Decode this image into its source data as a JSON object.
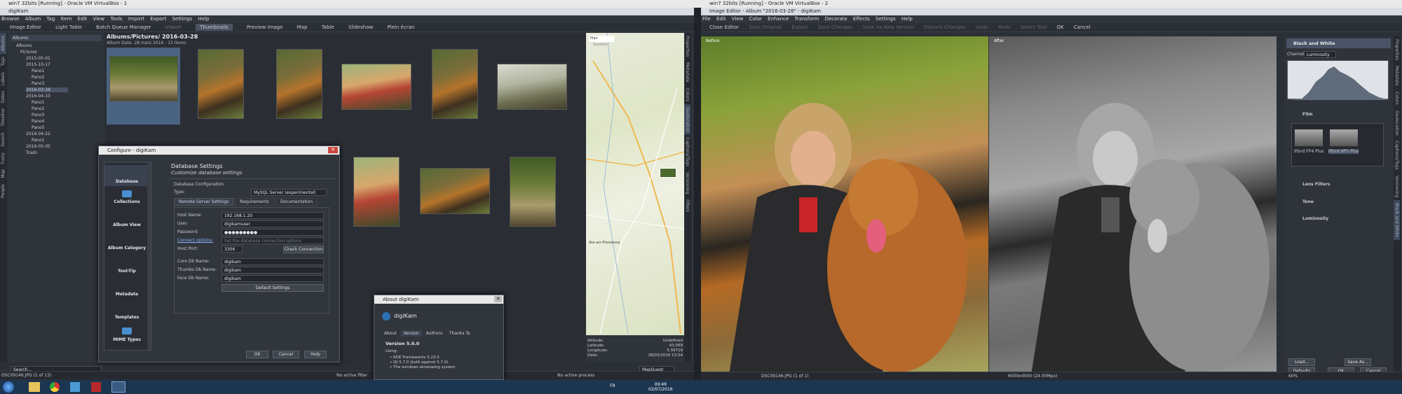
{
  "vm_bar": {
    "left_title": "win7 32bits [Running] - Oracle VM VirtualBox - 1",
    "right_title": "win7 32bits [Running] - Oracle VM VirtualBox - 2"
  },
  "digikam": {
    "title": "digiKam",
    "menu": [
      "Browse",
      "Album",
      "Tag",
      "Item",
      "Edit",
      "View",
      "Tools",
      "Import",
      "Export",
      "Settings",
      "Help"
    ],
    "toolbar": [
      "Image Editor",
      "Light Table",
      "Batch Queue Manager",
      "Import",
      "Thumbnails",
      "Preview Image",
      "Map",
      "Table",
      "Slideshow",
      "Plein écran"
    ],
    "left_tabs": [
      "Albums",
      "Tags",
      "Labels",
      "Dates",
      "Timeline",
      "Search",
      "Fuzzy",
      "Map",
      "People"
    ],
    "albums_header": "Albums",
    "tree": [
      "Albums",
      "Pictures",
      "2015-05-01",
      "2015-10-17",
      "Pano1",
      "Pano2",
      "Pano3",
      "2016-03-28",
      "2016-04-10",
      "Pano1",
      "Pano2",
      "Pano3",
      "Pano4",
      "Pano5",
      "2016-04-22",
      "Pano1",
      "2016-05-05",
      "Trash"
    ],
    "breadcrumb": "Albums/Pictures/ 2016-03-28",
    "album_info": "Album Date: 28 mars 2016 - 13 Items",
    "right_tabs": [
      "Properties",
      "Metadata",
      "Colors",
      "Geolocation",
      "Captions/Tags",
      "Versioning",
      "Filters"
    ],
    "map": {
      "tabs": [
        "Plan",
        "Satellite"
      ],
      "city": "Aix-en-Provence",
      "altitude_label": "Altitude:",
      "altitude": "Undefined",
      "latitude_label": "Latitude:",
      "latitude": "43.569",
      "longitude_label": "Longitude:",
      "longitude": "5.39719",
      "date_label": "Date:",
      "date": "28/03/2016 13:54",
      "provider": "MapQuest"
    },
    "search_placeholder": "Search...",
    "status_file": "DSC09146.JPG (1 of 13)",
    "status_filter": "No active filter",
    "status_process": "No active process"
  },
  "config_dialog": {
    "title": "Configure - digiKam",
    "nav": [
      "Database",
      "Collections",
      "Album View",
      "Album Category",
      "Tool-Tip",
      "Metadata",
      "Templates",
      "MIME Types"
    ],
    "section_title": "Database Settings",
    "section_subtitle": "Customize database settings",
    "group": "Database Configuration",
    "type_label": "Type:",
    "type_value": "MySQL Server (experimental)",
    "tabs": [
      "Remote Server Settings",
      "Requirements",
      "Documentation"
    ],
    "host_label": "Host Name:",
    "host": "192.168.1.20",
    "user_label": "User:",
    "user": "digikamuser",
    "password_label": "Password:",
    "password": "●●●●●●●●●",
    "conn_label": "Connect options:",
    "conn_placeholder": "Set the database connection options",
    "port_label": "Host Port:",
    "port": "3306",
    "check_btn": "Check Connection",
    "core_label": "Core Db Name:",
    "core": "digikam",
    "thumbs_label": "Thumbs Db Name:",
    "thumbs": "digikam",
    "face_label": "Face Db Name:",
    "face": "digikam",
    "defaults_btn": "Default Settings",
    "ok": "OK",
    "cancel": "Cancel",
    "help": "Help"
  },
  "about_dialog": {
    "title": "About digiKam",
    "app": "digiKam",
    "tabs": [
      "About",
      "Version",
      "Authors",
      "Thanks To"
    ],
    "version": "Version 5.0.0",
    "using": "Using:",
    "items": [
      "KDE Frameworks 5.23.0",
      "Qt 5.7.0 (built against 5.7.0)",
      "The windows windowing system"
    ]
  },
  "editor": {
    "title": "Image Editor - Album \"2016-03-28\" - digiKam",
    "menu": [
      "File",
      "Edit",
      "View",
      "Color",
      "Enhance",
      "Transform",
      "Decorate",
      "Effects",
      "Settings",
      "Help"
    ],
    "toolbar": [
      "Close Editor",
      "Save Original",
      "Export",
      "Save Changes",
      "Save As New Version",
      "Discard Changes",
      "Undo",
      "Redo",
      "Select Tool",
      "OK",
      "Cancel"
    ],
    "before": "Before",
    "after": "After",
    "status_file": "DSC09146.JPG (1 of 1)",
    "status_size": "6000x4000 (24.00Mpx)",
    "zoom": "60%",
    "right_tabs": [
      "Properties",
      "Metadata",
      "Colors",
      "Geolocation",
      "Captions/Tags",
      "Versioning",
      "Black and White"
    ],
    "panel": {
      "title": "Black and White",
      "channel_label": "Channel:",
      "channel": "Luminosity",
      "film_header": "Film",
      "films": [
        "Ilford FP4 Plus",
        "Ilford HP5 Plus"
      ],
      "sections": [
        "Lens Filters",
        "Tone",
        "Luminosity"
      ],
      "load": "Load...",
      "save_as": "Save As...",
      "defaults": "Defaults",
      "ok": "Ok",
      "cancel": "Cancel"
    }
  },
  "taskbar": {
    "lang": "FR",
    "time": "09:49",
    "date": "02/07/2016"
  }
}
